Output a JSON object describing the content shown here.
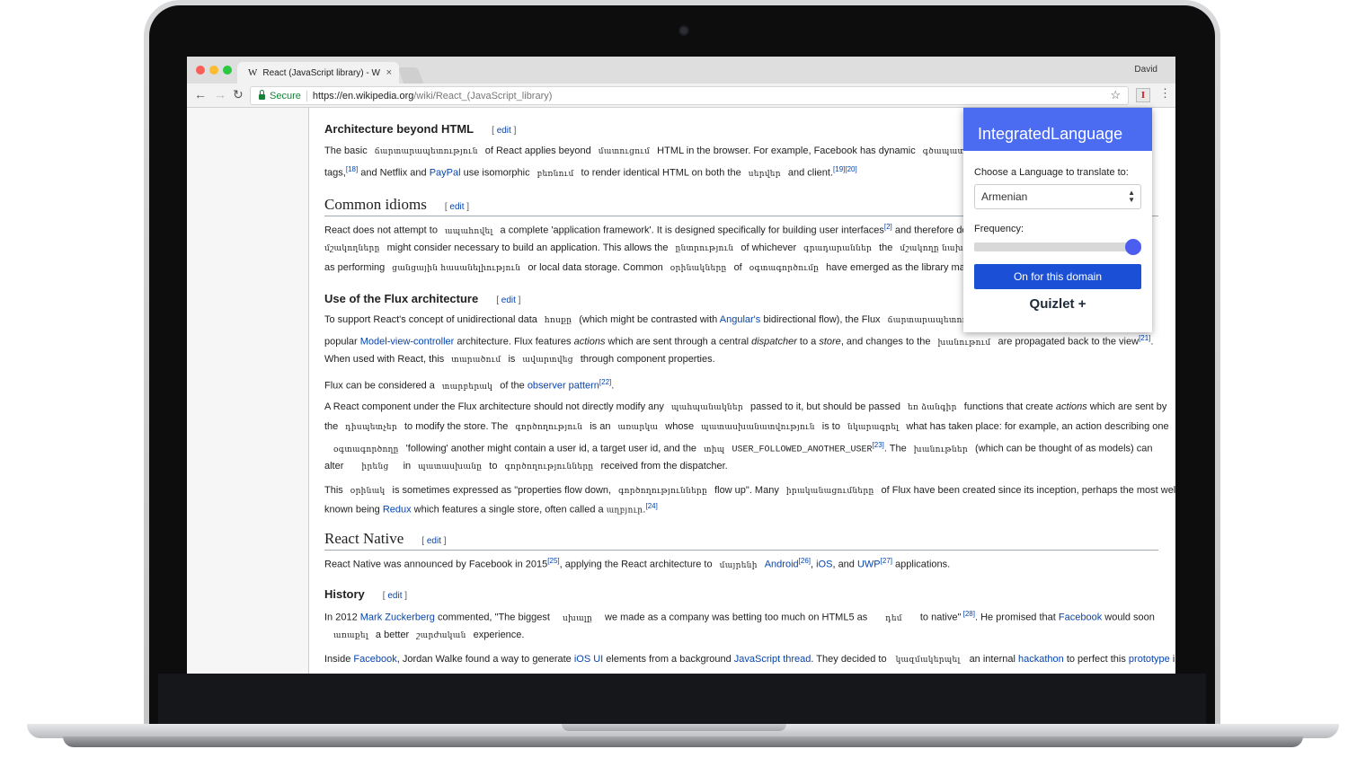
{
  "browser": {
    "tab_logo": "W",
    "tab_title": "React (JavaScript library) - W",
    "tab_close": "×",
    "user": "David",
    "secure_label": "Secure",
    "url_host": "https://en.wikipedia.org",
    "url_path": "/wiki/React_(JavaScript_library)",
    "back": "←",
    "forward": "→",
    "reload": "↻",
    "star": "☆",
    "ext_letter": "I",
    "menu": "⋮"
  },
  "article": {
    "sec_arch": {
      "title": "Architecture beyond HTML",
      "edit": "edit"
    },
    "arch_p1_l1": [
      "The basic",
      "ճարտարապետություն",
      "of React applies beyond",
      "մատուցում",
      "HTML in the browser. For example, Facebook has dynamic",
      "գծապատկերներ"
    ],
    "arch_p1_l2": [
      "tags,",
      "[18]",
      " and Netflix and ",
      "PayPal",
      " use isomorphic",
      "բեռնում",
      "to render identical HTML on both the",
      "սերվեր",
      "and client.",
      "[19][20]"
    ],
    "sec_idioms": {
      "title": "Common idioms",
      "edit": "edit"
    },
    "idioms_l1": [
      "React does not attempt to",
      "ապահովել",
      "a complete 'application framework'. It is designed specifically for building user interfaces",
      "[2]",
      " and therefore does"
    ],
    "idioms_l2": [
      "մշակողները",
      "might consider necessary to build an application. This allows the",
      "ընտրություն",
      "of whichever",
      "գրադարաններ",
      "the",
      "մշակողը նախընտրում"
    ],
    "idioms_l3": [
      "as performing",
      "ցանցային հասանելիություն",
      "or local data storage. Common",
      "օրինակները",
      "of",
      "օգտագործումը",
      "have emerged as the library matures."
    ],
    "sec_flux": {
      "title": "Use of the Flux architecture",
      "edit": "edit"
    },
    "flux_l1": [
      "To support React's concept of unidirectional data",
      "հոսքը",
      "(which might be contrasted with ",
      "Angular's",
      " bidirectional flow), the Flux",
      "ճարտարապետություն"
    ],
    "flux_l2": [
      "popular ",
      "Model-view-controller",
      " architecture. Flux features ",
      "actions",
      " which are sent through a central ",
      "dispatcher",
      " to a ",
      "store",
      ", and changes to the",
      "խանութում",
      "are propagated back to the view",
      "[21]",
      "."
    ],
    "flux_l3": [
      "When used with React, this",
      "տարածում",
      "is",
      "ավարտվեց",
      "through component properties."
    ],
    "flux_p2": [
      "Flux can be considered a",
      "տարբերակ",
      "of the ",
      "observer pattern",
      "[22]",
      "."
    ],
    "flux_p3_l1": [
      "A React component under the Flux architecture should not directly modify any",
      "պահպանակներ",
      "passed to it, but should be passed",
      "եռ ձանգիր",
      "functions that create ",
      "actions",
      " which are sent by"
    ],
    "flux_p3_l2": [
      "the",
      "դիսպետչեր",
      "to modify the store. The",
      "գործողություն",
      "is an",
      "առարկա",
      "whose",
      "պատասխանատվություն",
      "is to",
      "նկարագրել",
      "what has taken place: for example, an action describing one"
    ],
    "flux_p3_l3": [
      "օգտագործողը",
      "'following' another might contain a user id, a target user id, and the",
      "տիպ",
      "USER_FOLLOWED_ANOTHER_USER",
      "[23]",
      ". The",
      "խանութներ",
      "(which can be thought of as models) can"
    ],
    "flux_p3_l4": [
      "alter",
      "իրենց",
      "in",
      "պատասխանը",
      "to",
      "գործողությունները",
      "received from the dispatcher."
    ],
    "flux_p4_l1": [
      "This",
      "օրինակ",
      "is sometimes expressed as \"properties flow down,",
      "գործողությունները",
      "flow up\". Many",
      "իրականացումները",
      "of Flux have been created since its inception, perhaps the most well-"
    ],
    "flux_p4_l2": [
      "known being ",
      "Redux",
      " which features a single store, often called a ",
      "աղբյուր",
      ".",
      "[24]"
    ],
    "sec_native": {
      "title": "React Native",
      "edit": "edit"
    },
    "native_l1": [
      "React Native was announced by Facebook in 2015",
      "[25]",
      ", applying the React architecture to",
      "մայրենի",
      "Android",
      "[26]",
      ", ",
      "iOS",
      ", and ",
      "UWP",
      "[27]",
      " applications."
    ],
    "sec_history": {
      "title": "History",
      "edit": "edit"
    },
    "hist_l1": [
      "In 2012 ",
      "Mark Zuckerberg",
      " commented, \"The biggest",
      "սխալը",
      "we made as a company was betting too much on HTML5 as",
      "դեմ",
      "to native\"",
      " [28]",
      ". He promised that ",
      "Facebook",
      " would soon"
    ],
    "hist_l2": [
      "առաքել",
      "a better",
      "շարժական",
      "experience."
    ],
    "hist_l3": [
      "Inside ",
      "Facebook",
      ", Jordan Walke found a way to generate ",
      "iOS UI",
      " elements from a background ",
      "JavaScript thread",
      ". They decided to",
      "կազմակերպել",
      "an internal ",
      "hackathon",
      " to perfect this ",
      "prototype",
      " in"
    ]
  },
  "extension": {
    "title": "IntegratedLanguage",
    "choose_label": "Choose a Language to translate to:",
    "language": "Armenian",
    "frequency_label": "Frequency:",
    "frequency_level": 1.0,
    "button": "On for this domain",
    "quizlet": "Quizlet +",
    "accent": "#4b6cf0"
  }
}
